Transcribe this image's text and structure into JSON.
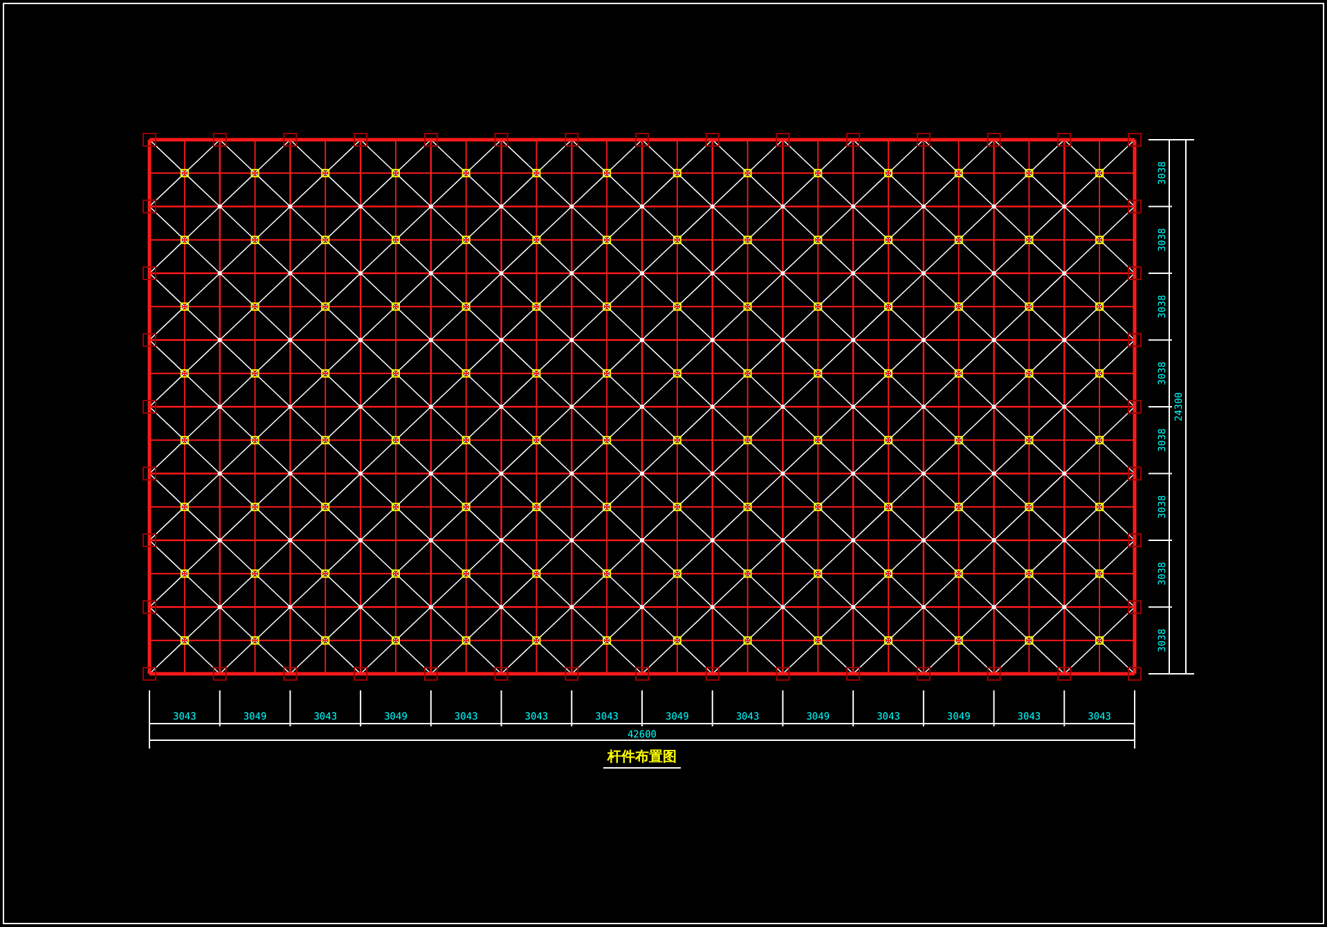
{
  "drawing": {
    "title": "杆件布置图",
    "horizontal_dimensions": [
      "3043",
      "3049",
      "3043",
      "3049",
      "3043",
      "3043",
      "3043",
      "3049",
      "3043",
      "3049",
      "3043",
      "3049",
      "3043",
      "3043"
    ],
    "horizontal_total": "42600",
    "vertical_dimensions": [
      "3038",
      "3038",
      "3038",
      "3038",
      "3038",
      "3038",
      "3038",
      "3038"
    ],
    "vertical_total": "24300"
  }
}
